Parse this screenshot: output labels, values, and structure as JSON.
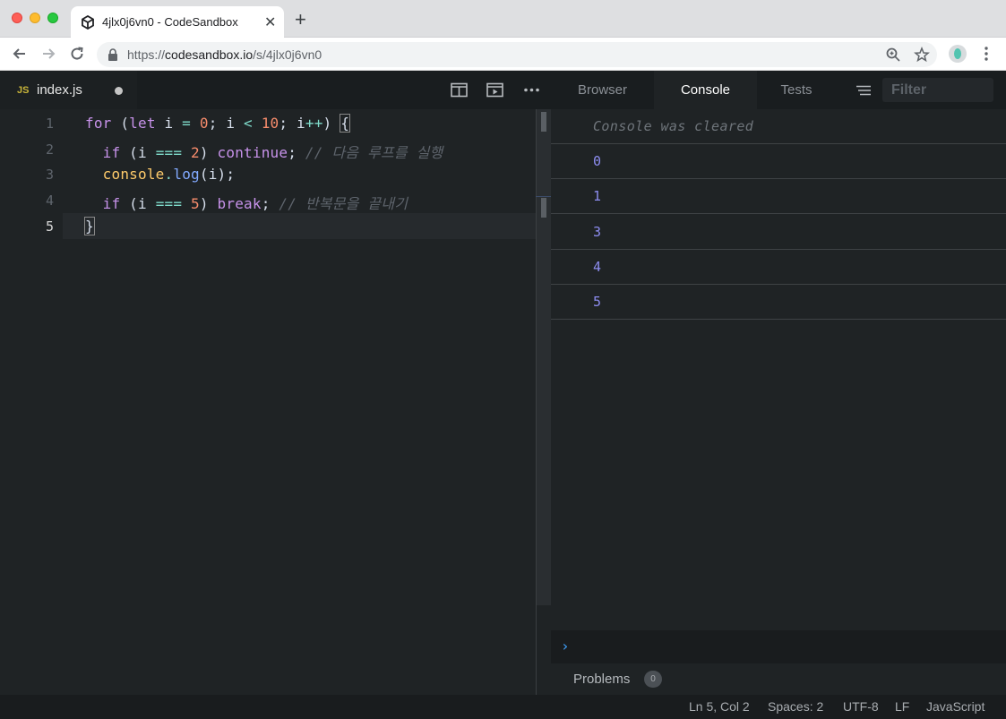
{
  "browser": {
    "tab_title": "4jlx0j6vn0 - CodeSandbox",
    "url_prefix": "https://",
    "url_host": "codesandbox.io",
    "url_path": "/s/4jlx0j6vn0"
  },
  "editor": {
    "file_badge": "JS",
    "file_name": "index.js",
    "line_numbers": [
      "1",
      "2",
      "3",
      "4",
      "5"
    ],
    "active_line": 5,
    "code": [
      "for (let i = 0; i < 10; i++) {",
      "  if (i === 2) continue; // 다음 루프를 실행",
      "  console.log(i);",
      "  if (i === 5) break; // 반복문을 끝내기",
      "}"
    ],
    "code_tokens": {
      "l1": {
        "for": "for",
        "p1": " (",
        "let": "let",
        "i": " i ",
        "eq": "=",
        "zero": " 0",
        "semi1": "; i ",
        "lt": "<",
        "ten": " 10",
        "semi2": "; i",
        "inc": "++",
        "close": ") ",
        "brace": "{"
      },
      "l2": {
        "indent": "  ",
        "if": "if",
        "p1": " (i ",
        "eq": "===",
        "two": " 2",
        "close": ") ",
        "cont": "continue",
        "semi": "; ",
        "comment": "// 다음 루프를 실행"
      },
      "l3": {
        "indent": "  ",
        "obj": "console",
        "dot": ".",
        "fn": "log",
        "args": "(i);"
      },
      "l4": {
        "indent": "  ",
        "if": "if",
        "p1": " (i ",
        "eq": "===",
        "five": " 5",
        "close": ") ",
        "brk": "break",
        "semi": "; ",
        "comment": "// 반복문을 끝내기"
      },
      "l5": {
        "brace": "}"
      }
    }
  },
  "panel": {
    "tabs": [
      "Browser",
      "Console",
      "Tests"
    ],
    "active_tab": "Console",
    "filter_placeholder": "Filter"
  },
  "console": {
    "cleared_message": "Console was cleared",
    "outputs": [
      "0",
      "1",
      "3",
      "4",
      "5"
    ],
    "prompt_symbol": "›"
  },
  "problems": {
    "label": "Problems",
    "count": "0"
  },
  "status": {
    "position": "Ln 5, Col 2",
    "spaces": "Spaces: 2",
    "encoding": "UTF-8",
    "eol": "LF",
    "language": "JavaScript"
  },
  "colors": {
    "keyword": "#c792ea",
    "number": "#f78c6c",
    "operator": "#7fdbca",
    "object": "#ffcb6b",
    "function": "#82aaff",
    "comment": "#5e646c",
    "console_output": "#8d8df0"
  }
}
